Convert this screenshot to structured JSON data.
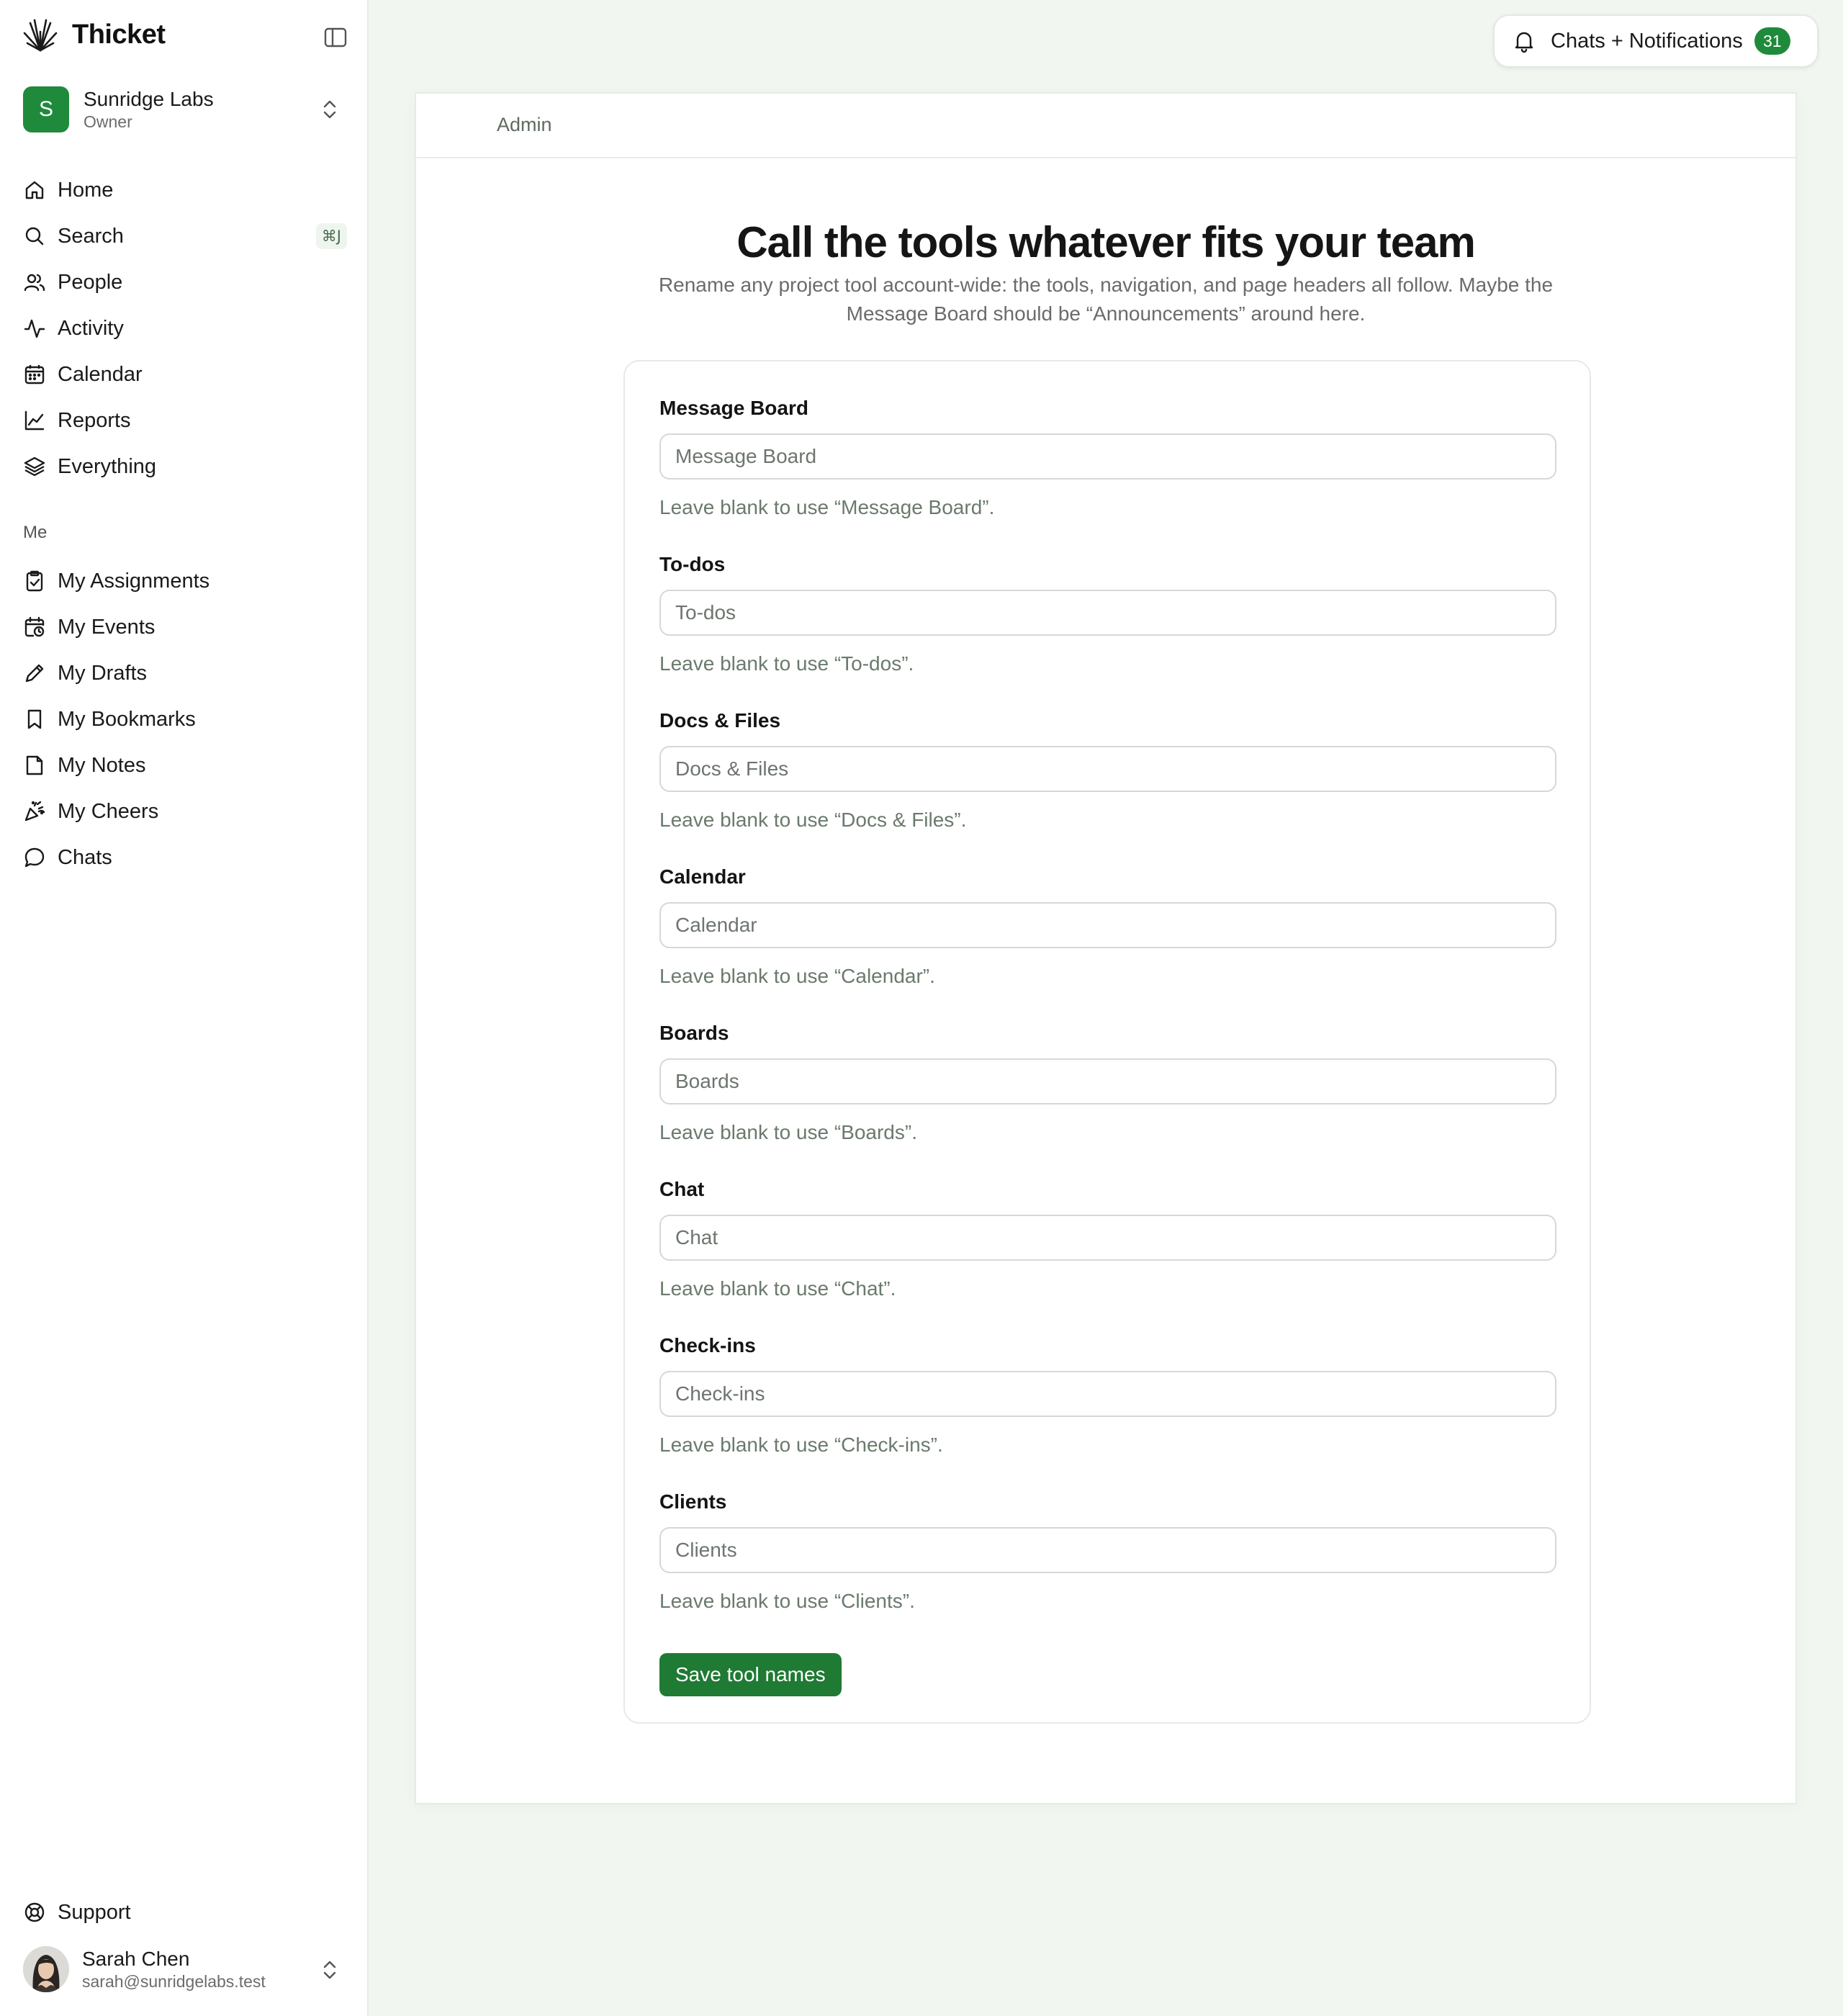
{
  "app": {
    "name": "Thicket",
    "logo_icon": "thicket-logo-icon"
  },
  "org": {
    "initial": "S",
    "name": "Sunridge Labs",
    "role": "Owner",
    "color": "#1f8a3b"
  },
  "nav": {
    "primary": [
      {
        "label": "Home",
        "icon": "home-icon"
      },
      {
        "label": "Search",
        "icon": "search-icon",
        "shortcut": "⌘J"
      },
      {
        "label": "People",
        "icon": "people-icon"
      },
      {
        "label": "Activity",
        "icon": "activity-icon"
      },
      {
        "label": "Calendar",
        "icon": "calendar-icon"
      },
      {
        "label": "Reports",
        "icon": "reports-icon"
      },
      {
        "label": "Everything",
        "icon": "layers-icon"
      }
    ],
    "section_label": "Me",
    "me": [
      {
        "label": "My Assignments",
        "icon": "clipboard-check-icon"
      },
      {
        "label": "My Events",
        "icon": "calendar-clock-icon"
      },
      {
        "label": "My Drafts",
        "icon": "pencil-icon"
      },
      {
        "label": "My Bookmarks",
        "icon": "bookmark-icon"
      },
      {
        "label": "My Notes",
        "icon": "note-icon"
      },
      {
        "label": "My Cheers",
        "icon": "party-popper-icon"
      },
      {
        "label": "Chats",
        "icon": "chat-bubble-icon"
      }
    ],
    "support": "Support"
  },
  "user": {
    "name": "Sarah Chen",
    "email": "sarah@sunridgelabs.test"
  },
  "notifications": {
    "label": "Chats + Notifications",
    "count": "31"
  },
  "page": {
    "breadcrumb": "Admin",
    "title": "Call the tools whatever fits your team",
    "subtitle": "Rename any project tool account-wide: the tools, navigation, and page headers all follow. Maybe the Message Board should be “Announcements” around here."
  },
  "form": {
    "fields": [
      {
        "label": "Message Board",
        "value": "",
        "placeholder": "Message Board",
        "help": "Leave blank to use “Message Board”."
      },
      {
        "label": "To-dos",
        "value": "",
        "placeholder": "To-dos",
        "help": "Leave blank to use “To-dos”."
      },
      {
        "label": "Docs & Files",
        "value": "",
        "placeholder": "Docs & Files",
        "help": "Leave blank to use “Docs & Files”."
      },
      {
        "label": "Calendar",
        "value": "",
        "placeholder": "Calendar",
        "help": "Leave blank to use “Calendar”."
      },
      {
        "label": "Boards",
        "value": "",
        "placeholder": "Boards",
        "help": "Leave blank to use “Boards”."
      },
      {
        "label": "Chat",
        "value": "",
        "placeholder": "Chat",
        "help": "Leave blank to use “Chat”."
      },
      {
        "label": "Check-ins",
        "value": "",
        "placeholder": "Check-ins",
        "help": "Leave blank to use “Check-ins”."
      },
      {
        "label": "Clients",
        "value": "",
        "placeholder": "Clients",
        "help": "Leave blank to use “Clients”."
      }
    ],
    "submit_label": "Save tool names"
  },
  "colors": {
    "accent": "#1f7a33",
    "background": "#f1f6f0"
  }
}
